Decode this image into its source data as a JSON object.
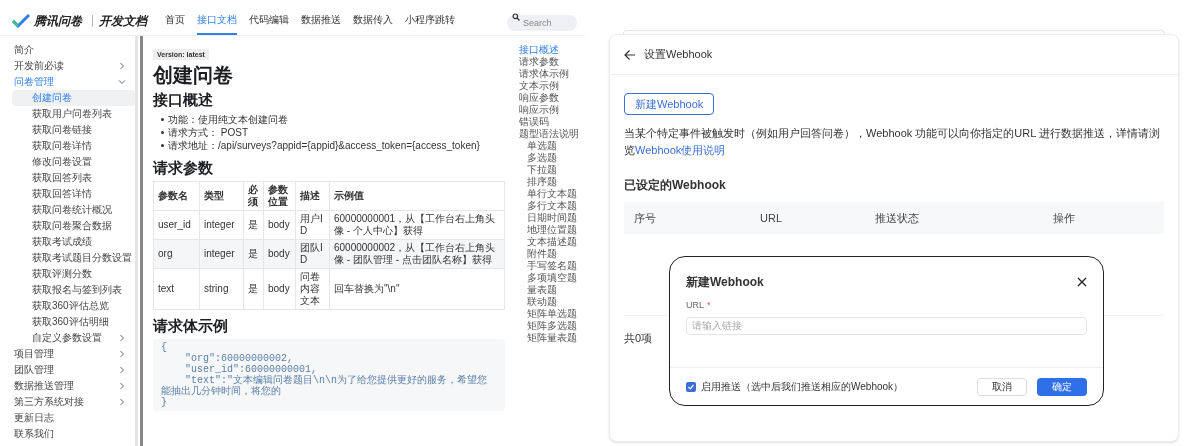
{
  "docs": {
    "logo": {
      "name": "腾讯问卷",
      "subtitle": "开发文档"
    },
    "nav": [
      {
        "label": "首页",
        "selected": false
      },
      {
        "label": "接口文档",
        "selected": true
      },
      {
        "label": "代码编辑",
        "selected": false
      },
      {
        "label": "数据推送",
        "selected": false
      },
      {
        "label": "数据传入",
        "selected": false
      },
      {
        "label": "小程序跳转",
        "selected": false
      }
    ],
    "search": {
      "placeholder": "Search"
    },
    "sidebar": [
      {
        "label": "简介",
        "selected": false
      },
      {
        "label": "开发前必读",
        "selected": false,
        "expanded": false
      },
      {
        "label": "问卷管理",
        "selected": false,
        "expanded": true,
        "children": [
          {
            "label": "创建问卷",
            "selected": true
          },
          {
            "label": "获取用户问卷列表",
            "selected": false
          },
          {
            "label": "获取问卷链接",
            "selected": false
          },
          {
            "label": "获取问卷详情",
            "selected": false
          },
          {
            "label": "修改问卷设置",
            "selected": false
          },
          {
            "label": "获取回答列表",
            "selected": false
          },
          {
            "label": "获取回答详情",
            "selected": false
          },
          {
            "label": "获取问卷统计概况",
            "selected": false
          },
          {
            "label": "获取问卷聚合数据",
            "selected": false
          },
          {
            "label": "获取考试成绩",
            "selected": false
          },
          {
            "label": "获取考试题目分数设置",
            "selected": false
          },
          {
            "label": "获取评测分数",
            "selected": false
          },
          {
            "label": "获取报名与签到列表",
            "selected": false
          },
          {
            "label": "获取360评估总览",
            "selected": false
          },
          {
            "label": "获取360评估明细",
            "selected": false
          },
          {
            "label": "自定义参数设置",
            "selected": false,
            "expanded": false
          }
        ]
      },
      {
        "label": "项目管理",
        "selected": false,
        "expanded": false
      },
      {
        "label": "团队管理",
        "selected": false,
        "expanded": false
      },
      {
        "label": "数据推送管理",
        "selected": false,
        "expanded": false
      },
      {
        "label": "第三方系统对接",
        "selected": false,
        "expanded": false
      },
      {
        "label": "更新日志",
        "selected": false
      },
      {
        "label": "联系我们",
        "selected": false
      }
    ],
    "version": "Version: latest",
    "title": "创建问卷",
    "overview": {
      "heading": "接口概述",
      "bullets": [
        "功能：使用纯文本创建问卷",
        "请求方式： POST",
        "请求地址：/api/surveys?appid={appid}&access_token={access_token}"
      ]
    },
    "params": {
      "heading": "请求参数",
      "columns": [
        "参数名",
        "类型",
        "必须",
        "参数位置",
        "描述",
        "示例值"
      ],
      "rows": [
        [
          "user_id",
          "integer",
          "是",
          "body",
          "用户ID",
          "60000000001，从【工作台右上角头像 - 个人中心】获得"
        ],
        [
          "org",
          "integer",
          "是",
          "body",
          "团队ID",
          "60000000002，从【工作台右上角头像 - 团队管理 - 点击团队名称】获得"
        ],
        [
          "text",
          "string",
          "是",
          "body",
          "问卷内容文本",
          "回车替换为\"\\n\""
        ]
      ]
    },
    "example": {
      "heading": "请求体示例",
      "code": [
        "{",
        "    \"org\":60000000002,",
        "    \"user_id\":60000000001,",
        "    \"text\":\"文本编辑问卷题目\\n\\n为了给您提供更好的服务，希望您能抽出几分钟时间，将您的",
        "}"
      ]
    },
    "toc": [
      {
        "label": "接口概述",
        "selected": true
      },
      {
        "label": "请求参数",
        "selected": false
      },
      {
        "label": "请求体示例",
        "selected": false
      },
      {
        "label": "文本示例",
        "selected": false
      },
      {
        "label": "响应参数",
        "selected": false
      },
      {
        "label": "响应示例",
        "selected": false
      },
      {
        "label": "错误码",
        "selected": false
      },
      {
        "label": "题型语法说明",
        "selected": false,
        "children": [
          {
            "label": "单选题",
            "selected": false
          },
          {
            "label": "多选题",
            "selected": false
          },
          {
            "label": "下拉题",
            "selected": false
          },
          {
            "label": "排序题",
            "selected": false
          },
          {
            "label": "单行文本题",
            "selected": false
          },
          {
            "label": "多行文本题",
            "selected": false
          },
          {
            "label": "日期时间题",
            "selected": false
          },
          {
            "label": "地理位置题",
            "selected": false
          },
          {
            "label": "文本描述题",
            "selected": false
          },
          {
            "label": "附件题",
            "selected": false
          },
          {
            "label": "手写签名题",
            "selected": false
          },
          {
            "label": "多项填空题",
            "selected": false
          },
          {
            "label": "量表题",
            "selected": false
          },
          {
            "label": "联动题",
            "selected": false
          },
          {
            "label": "矩阵单选题",
            "selected": false
          },
          {
            "label": "矩阵多选题",
            "selected": false
          },
          {
            "label": "矩阵量表题",
            "selected": false
          }
        ]
      }
    ]
  },
  "webhook": {
    "title": "设置Webhook",
    "new_button": "新建Webhook",
    "description": "当某个特定事件被触发时（例如用户回答问卷），Webhook 功能可以向你指定的URL 进行数据推送，详情请浏览",
    "description_link": "Webhook使用说明",
    "list_heading": "已设定的Webhook",
    "columns": [
      "序号",
      "URL",
      "推送状态",
      "操作"
    ],
    "total": "共0项",
    "dialog": {
      "title": "新建Webhook",
      "url_label": "URL",
      "required_mark": "*",
      "url_placeholder": "请输入链接",
      "enable_label": "启用推送（选中后我们推送相应的Webhook）",
      "enable_checked": true,
      "cancel": "取消",
      "confirm": "确定"
    }
  }
}
